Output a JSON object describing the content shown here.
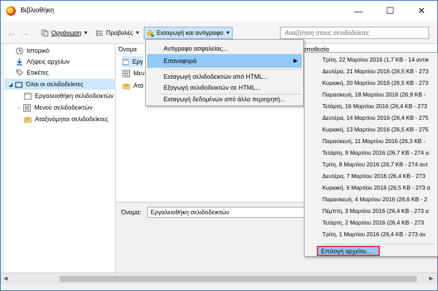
{
  "window": {
    "title": "Βιβλιοθήκη",
    "minimize": "—",
    "maximize": "☐",
    "close": "✕"
  },
  "toolbar": {
    "back": "←",
    "forward": "→",
    "organize": "Οργάνωση",
    "views": "Προβολές",
    "import_backup": "Εισαγωγή και αντίγραφο",
    "search_placeholder": "Αναζήτηση στους σελιδοδείκτες"
  },
  "sidebar": {
    "items": [
      {
        "label": "Ιστορικό",
        "icon": "clock-icon"
      },
      {
        "label": "Λήψεις αρχείων",
        "icon": "download-icon"
      },
      {
        "label": "Ετικέτες",
        "icon": "tag-icon"
      },
      {
        "label": "Όλοι οι σελιδοδείκτες",
        "icon": "bookmarks-folder-icon"
      },
      {
        "label": "Εργαλειοθήκη σελιδοδεικτών",
        "icon": "toolbar-icon"
      },
      {
        "label": "Μενού σελιδοδεικτών",
        "icon": "menu-icon"
      },
      {
        "label": "Αταξινόμητοι σελιδοδείκτες",
        "icon": "star-folder-icon"
      }
    ]
  },
  "list": {
    "col_name": "Όνομα",
    "col_location": "οποθεσία",
    "rows": [
      "Εργ",
      "Μεν",
      "Ατα"
    ]
  },
  "details": {
    "name_label": "Όνομα:",
    "name_value": "Εργαλειοθήκη σελιδοδεικτών"
  },
  "import_menu": {
    "backup": "Αντίγραφο ασφαλείας...",
    "restore": "Επαναφορά",
    "import_html": "Εισαγωγή σελιδοδεικτών από HTML...",
    "export_html": "Εξαγωγή σελιδοδεικτών σε HTML...",
    "import_other": "Εισαγωγή δεδομένων από άλλο περιηγητή..."
  },
  "restore_menu": {
    "backups": [
      "Τρίτη, 22 Μαρτίου 2016 (1,7 KB - 14 αντικ",
      "Δευτέρα, 21 Μαρτίου 2016 (26,5 KB - 273",
      "Κυριακή, 20 Μαρτίου 2016 (26,5 KB - 273",
      "Παρασκευή, 18 Μαρτίου 2016 (26,9 KB -",
      "Τετάρτη, 16 Μαρτίου 2016 (26,4 KB - 273",
      "Δευτέρα, 14 Μαρτίου 2016 (26,4 KB - 275",
      "Κυριακή, 13 Μαρτίου 2016 (26,5 KB - 275",
      "Παρασκευή, 11 Μαρτίου 2016 (26,3 KB -",
      "Τετάρτη, 9 Μαρτίου 2016 (26,7 KB - 274 α",
      "Τρίτη, 8 Μαρτίου 2016 (26,7 KB - 274 αντ",
      "Δευτέρα, 7 Μαρτίου 2016 (26,4 KB - 273",
      "Κυριακή, 6 Μαρτίου 2016 (26,5 KB - 273 α",
      "Παρασκευή, 4 Μαρτίου 2016 (26,6 KB - 2",
      "Πέμπτη, 3 Μαρτίου 2016 (26,4 KB - 273 α",
      "Τετάρτη, 2 Μαρτίου 2016 (26,4 KB - 273",
      "Τρίτη, 1 Μαρτίου 2016 (26,4 KB - 273 αν"
    ],
    "choose_file": "Επιλογή αρχείου..."
  }
}
